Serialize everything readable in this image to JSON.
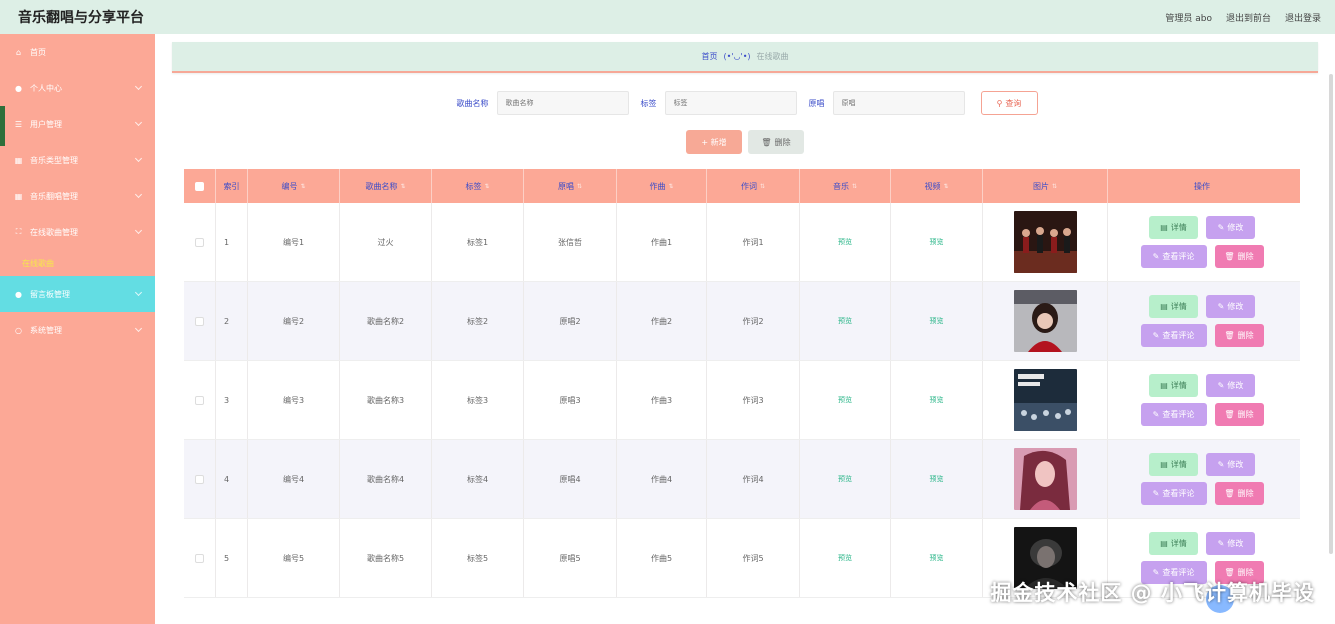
{
  "header": {
    "app_title": "音乐翻唱与分享平台",
    "admin_label": "管理员 abo",
    "exit_front": "退出到前台",
    "logout": "退出登录",
    "bg_color": "#ddefe6"
  },
  "sidebar": {
    "bg_color": "#fca896",
    "active_color": "#63dde3",
    "items": [
      {
        "label": "首页",
        "icon": "home-icon"
      },
      {
        "label": "个人中心",
        "icon": "user-icon"
      },
      {
        "label": "用户管理",
        "icon": "list-icon"
      },
      {
        "label": "音乐类型管理",
        "icon": "grid-icon"
      },
      {
        "label": "音乐翻唱管理",
        "icon": "grid-icon"
      },
      {
        "label": "在线歌曲管理",
        "icon": "frame-icon"
      },
      {
        "label": "留言板管理",
        "icon": "user-icon"
      },
      {
        "label": "系统管理",
        "icon": "gear-icon"
      }
    ],
    "sub_item": "在线歌曲"
  },
  "breadcrumb": {
    "home": "首页",
    "face": "(•'◡'•)",
    "current": "在线歌曲"
  },
  "filters": {
    "song_label": "歌曲名称",
    "song_placeholder": "歌曲名称",
    "tag_label": "标签",
    "tag_placeholder": "标签",
    "orig_label": "原唱",
    "orig_placeholder": "原唱",
    "search_btn": "查询"
  },
  "actions": {
    "add": "+ 新增",
    "delete": "删除"
  },
  "table": {
    "headers": [
      "索引",
      "编号",
      "歌曲名称",
      "标签",
      "原唱",
      "作曲",
      "作词",
      "音乐",
      "视频",
      "图片",
      "操作"
    ],
    "rows": [
      {
        "idx": "1",
        "code": "编号1",
        "name": "过火",
        "tag": "标签1",
        "orig": "张信哲",
        "comp": "作曲1",
        "lyr": "作词1",
        "music": "预览",
        "video": "预览"
      },
      {
        "idx": "2",
        "code": "编号2",
        "name": "歌曲名称2",
        "tag": "标签2",
        "orig": "原唱2",
        "comp": "作曲2",
        "lyr": "作词2",
        "music": "预览",
        "video": "预览"
      },
      {
        "idx": "3",
        "code": "编号3",
        "name": "歌曲名称3",
        "tag": "标签3",
        "orig": "原唱3",
        "comp": "作曲3",
        "lyr": "作词3",
        "music": "预览",
        "video": "预览"
      },
      {
        "idx": "4",
        "code": "编号4",
        "name": "歌曲名称4",
        "tag": "标签4",
        "orig": "原唱4",
        "comp": "作曲4",
        "lyr": "作词4",
        "music": "预览",
        "video": "预览"
      },
      {
        "idx": "5",
        "code": "编号5",
        "name": "歌曲名称5",
        "tag": "标签5",
        "orig": "原唱5",
        "comp": "作曲5",
        "lyr": "作词5",
        "music": "预览",
        "video": "预览"
      }
    ],
    "ops": {
      "detail": "详情",
      "edit": "修改",
      "comments": "查看评论",
      "delete": "删除"
    }
  },
  "watermark": "掘金技术社区 @ 小飞计算机毕设"
}
